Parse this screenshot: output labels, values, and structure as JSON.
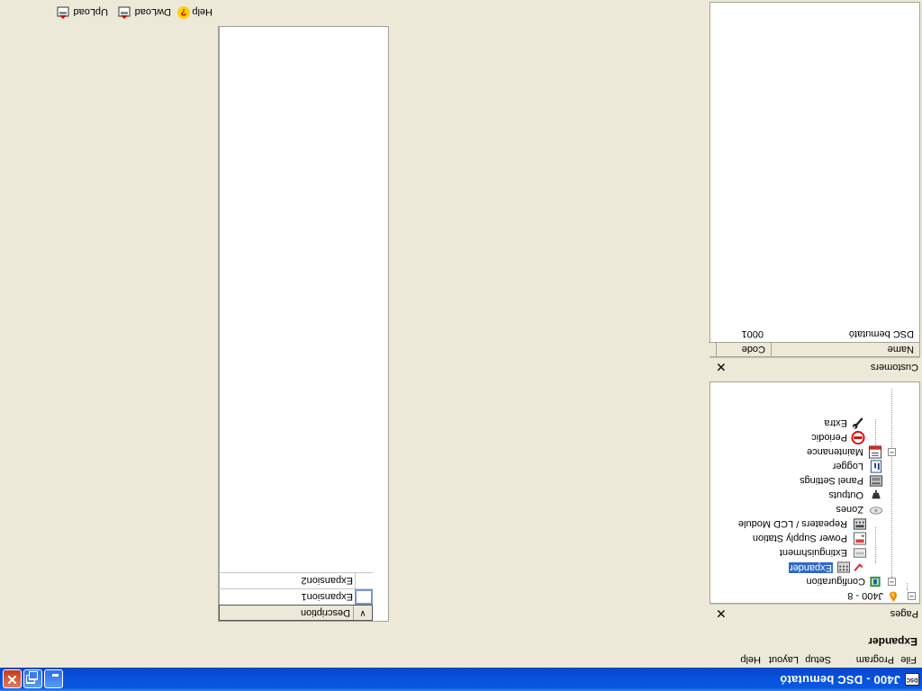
{
  "window": {
    "title": "J400 - DSC bemutató",
    "icon_label": "DSC"
  },
  "menu": [
    "File",
    "Program",
    "Setup",
    "Layout",
    "Help"
  ],
  "page_header": "Expander",
  "pages_panel": {
    "caption": "Pages",
    "tree": [
      {
        "label": "J400 - 8",
        "icon": "fire-panel-icon",
        "level": 0,
        "expanded": true
      },
      {
        "label": "Configuration",
        "icon": "configuration-icon",
        "level": 1,
        "expanded": true
      },
      {
        "label": "Expander",
        "icon": "expander-module-icon",
        "level": 2,
        "selected": true
      },
      {
        "label": "Extinguishment",
        "icon": "extinguishment-icon",
        "level": 2
      },
      {
        "label": "Power Supply Station",
        "icon": "power-supply-icon",
        "level": 2
      },
      {
        "label": "Repeaters / LCD Module",
        "icon": "lcd-module-icon",
        "level": 2
      },
      {
        "label": "Zones",
        "icon": "detector-icon",
        "level": 1
      },
      {
        "label": "Outputs",
        "icon": "siren-icon",
        "level": 1
      },
      {
        "label": "Panel Settings",
        "icon": "panel-settings-icon",
        "level": 1
      },
      {
        "label": "Logger",
        "icon": "logger-icon",
        "level": 1
      },
      {
        "label": "Maintenance",
        "icon": "maintenance-icon",
        "level": 1,
        "expanded": true
      },
      {
        "label": "Periodic",
        "icon": "no-entry-icon",
        "level": 2
      },
      {
        "label": "Extra",
        "icon": "wrench-icon",
        "level": 2
      }
    ]
  },
  "customers_panel": {
    "caption": "Customers",
    "columns": [
      "Name",
      "Code"
    ],
    "rows": [
      {
        "name": "DSC bemutató",
        "code": "0001"
      }
    ]
  },
  "grid": {
    "column": "Description",
    "rows": [
      "Expansion1",
      "Expansion2"
    ]
  },
  "toolbar": {
    "upload_label": "UpLoad",
    "download_label": "DwLoad",
    "help_label": "Help"
  },
  "colors": {
    "titlebar": "#0550dc",
    "face": "#ece9d8",
    "selection": "#316ac5"
  }
}
